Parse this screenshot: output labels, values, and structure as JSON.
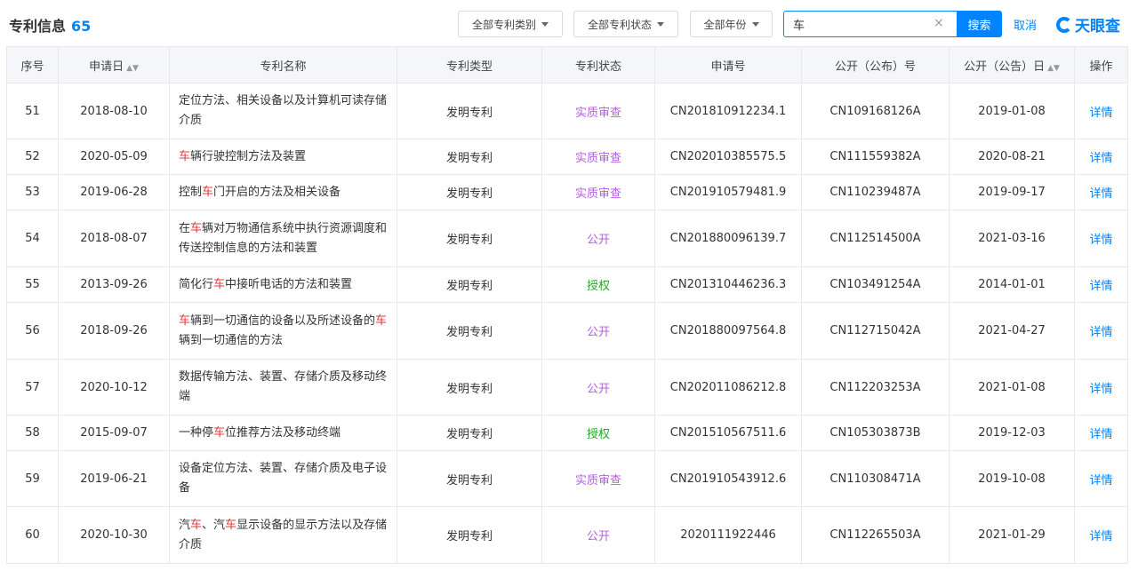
{
  "header": {
    "title": "专利信息",
    "count": "65"
  },
  "filters": {
    "type_label": "全部专利类别",
    "status_label": "全部专利状态",
    "year_label": "全部年份"
  },
  "search": {
    "value": "车",
    "clear": "×",
    "button": "搜索",
    "cancel": "取消"
  },
  "brand": {
    "logo_text": "天眼查"
  },
  "table": {
    "columns": [
      "序号",
      "申请日",
      "专利名称",
      "专利类型",
      "专利状态",
      "申请号",
      "公开（公布）号",
      "公开（公告）日",
      "操作"
    ],
    "rows": [
      {
        "no": "51",
        "date": "2018-08-10",
        "name": [
          "定位方法、相关设备以及计算机可读",
          "存储介质"
        ],
        "name_parts": [
          {
            "t": "定位方法、相关设备以及计算机可读存储介质",
            "hl": false
          }
        ],
        "type": "发明专利",
        "status": "实质审查",
        "status_kind": "review",
        "app_no": "CN201810912234.1",
        "pub_no": "CN109168126A",
        "pub_date": "2019-01-08",
        "action": "详情"
      },
      {
        "no": "52",
        "date": "2020-05-09",
        "name_parts": [
          {
            "t": "车",
            "hl": true
          },
          {
            "t": "辆行驶控制方法及装置",
            "hl": false
          }
        ],
        "type": "发明专利",
        "status": "实质审查",
        "status_kind": "review",
        "app_no": "CN202010385575.5",
        "pub_no": "CN111559382A",
        "pub_date": "2020-08-21",
        "action": "详情"
      },
      {
        "no": "53",
        "date": "2019-06-28",
        "name_parts": [
          {
            "t": "控制",
            "hl": false
          },
          {
            "t": "车",
            "hl": true
          },
          {
            "t": "门开启的方法及相关设备",
            "hl": false
          }
        ],
        "type": "发明专利",
        "status": "实质审查",
        "status_kind": "review",
        "app_no": "CN201910579481.9",
        "pub_no": "CN110239487A",
        "pub_date": "2019-09-17",
        "action": "详情"
      },
      {
        "no": "54",
        "date": "2018-08-07",
        "name_parts": [
          {
            "t": "在",
            "hl": false
          },
          {
            "t": "车",
            "hl": true
          },
          {
            "t": "辆对万物通信系统中执行资源调度和传送控制信息的方法和装置",
            "hl": false
          }
        ],
        "type": "发明专利",
        "status": "公开",
        "status_kind": "public",
        "app_no": "CN201880096139.7",
        "pub_no": "CN112514500A",
        "pub_date": "2021-03-16",
        "action": "详情"
      },
      {
        "no": "55",
        "date": "2013-09-26",
        "name_parts": [
          {
            "t": "简化行",
            "hl": false
          },
          {
            "t": "车",
            "hl": true
          },
          {
            "t": "中接听电话的方法和装置",
            "hl": false
          }
        ],
        "type": "发明专利",
        "status": "授权",
        "status_kind": "grant",
        "app_no": "CN201310446236.3",
        "pub_no": "CN103491254A",
        "pub_date": "2014-01-01",
        "action": "详情"
      },
      {
        "no": "56",
        "date": "2018-09-26",
        "name_parts": [
          {
            "t": "车",
            "hl": true
          },
          {
            "t": "辆到一切通信的设备以及所述设备的",
            "hl": false
          },
          {
            "t": "车",
            "hl": true
          },
          {
            "t": "辆到一切通信的方法",
            "hl": false
          }
        ],
        "type": "发明专利",
        "status": "公开",
        "status_kind": "public",
        "app_no": "CN201880097564.8",
        "pub_no": "CN112715042A",
        "pub_date": "2021-04-27",
        "action": "详情"
      },
      {
        "no": "57",
        "date": "2020-10-12",
        "name_parts": [
          {
            "t": "数据传输方法、装置、存储介质及移动终端",
            "hl": false
          }
        ],
        "type": "发明专利",
        "status": "公开",
        "status_kind": "public",
        "app_no": "CN202011086212.8",
        "pub_no": "CN112203253A",
        "pub_date": "2021-01-08",
        "action": "详情"
      },
      {
        "no": "58",
        "date": "2015-09-07",
        "name_parts": [
          {
            "t": "一种停",
            "hl": false
          },
          {
            "t": "车",
            "hl": true
          },
          {
            "t": "位推荐方法及移动终端",
            "hl": false
          }
        ],
        "type": "发明专利",
        "status": "授权",
        "status_kind": "grant",
        "app_no": "CN201510567511.6",
        "pub_no": "CN105303873B",
        "pub_date": "2019-12-03",
        "action": "详情"
      },
      {
        "no": "59",
        "date": "2019-06-21",
        "name_parts": [
          {
            "t": "设备定位方法、装置、存储介质及电子设备",
            "hl": false
          }
        ],
        "type": "发明专利",
        "status": "实质审查",
        "status_kind": "review",
        "app_no": "CN201910543912.6",
        "pub_no": "CN110308471A",
        "pub_date": "2019-10-08",
        "action": "详情"
      },
      {
        "no": "60",
        "date": "2020-10-30",
        "name_parts": [
          {
            "t": "汽",
            "hl": false
          },
          {
            "t": "车",
            "hl": true
          },
          {
            "t": "、汽",
            "hl": false
          },
          {
            "t": "车",
            "hl": true
          },
          {
            "t": "显示设备的显示方法以及存储介质",
            "hl": false
          }
        ],
        "type": "发明专利",
        "status": "公开",
        "status_kind": "public",
        "app_no": "2020111922446",
        "pub_no": "CN112265503A",
        "pub_date": "2021-01-29",
        "action": "详情"
      }
    ]
  },
  "colors": {
    "accent": "#0084ff",
    "highlight": "#e4393c",
    "status_review": "#b45ee0",
    "status_grant": "#27a527"
  }
}
